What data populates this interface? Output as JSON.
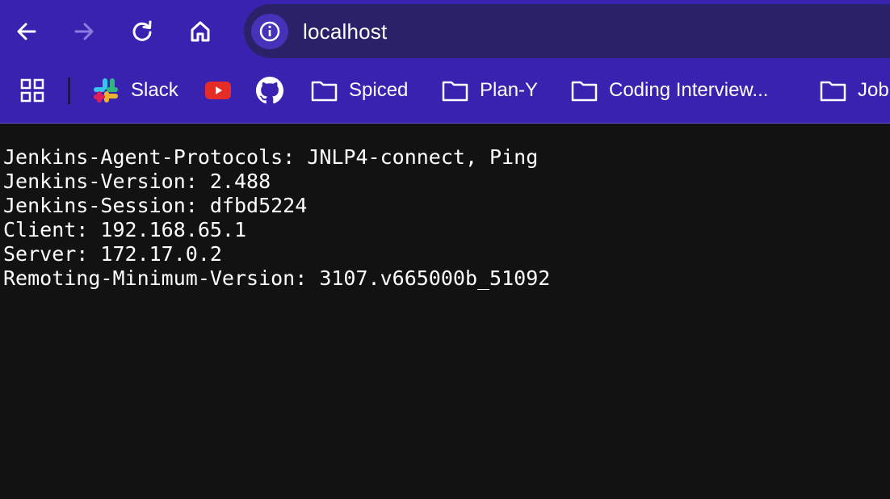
{
  "browser": {
    "url": "localhost",
    "icons": {
      "back": "arrow-left-icon",
      "forward": "arrow-right-icon",
      "reload": "reload-icon",
      "home": "home-icon",
      "site_info": "info-icon"
    },
    "colors": {
      "toolbar": "#3a22b0",
      "omnibox": "#2a2268",
      "page_background": "#121212",
      "text": "#ffffff"
    }
  },
  "bookmarks": [
    {
      "label": "",
      "icon": "apps-grid-icon"
    },
    {
      "label": "Slack",
      "icon": "slack-icon"
    },
    {
      "label": "",
      "icon": "youtube-icon"
    },
    {
      "label": "",
      "icon": "github-icon"
    },
    {
      "label": "Spiced",
      "icon": "folder-icon"
    },
    {
      "label": "Plan-Y",
      "icon": "folder-icon"
    },
    {
      "label": "Coding Interview...",
      "icon": "folder-icon"
    },
    {
      "label": "Job",
      "icon": "folder-icon"
    }
  ],
  "page": {
    "lines": [
      "Jenkins-Agent-Protocols: JNLP4-connect, Ping",
      "Jenkins-Version: 2.488",
      "Jenkins-Session: dfbd5224",
      "Client: 192.168.65.1",
      "Server: 172.17.0.2",
      "Remoting-Minimum-Version: 3107.v665000b_51092"
    ]
  }
}
